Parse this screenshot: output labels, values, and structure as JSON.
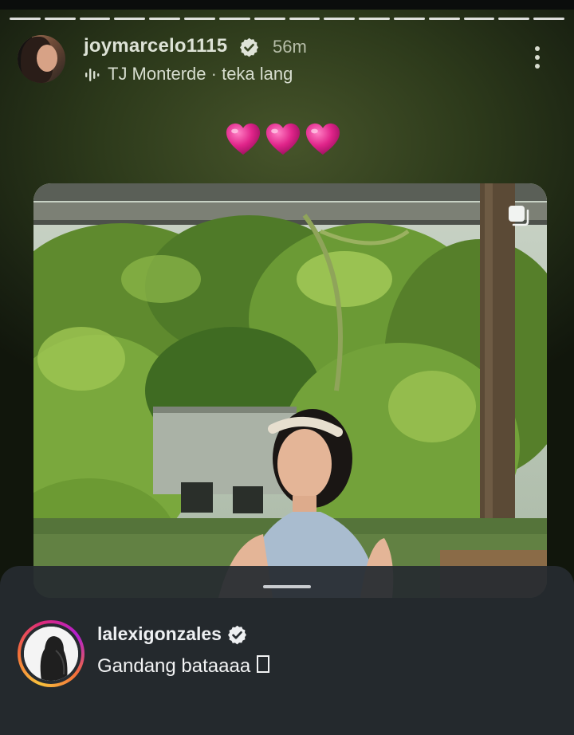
{
  "story": {
    "progress_segments": 16,
    "progress_active": 16,
    "user": {
      "username": "joymarcelo1115",
      "verified": true,
      "time_ago": "56m"
    },
    "music": {
      "icon": "audio-bars-icon",
      "artist": "TJ Monterde",
      "separator": "·",
      "song": "teka lang"
    },
    "more_icon": "more-vertical-icon",
    "caption_emoji": [
      "💗",
      "💗",
      "💗"
    ],
    "photo": {
      "multi_icon": "carousel-icon"
    }
  },
  "reply_sheet": {
    "commenter": "lalexigonzales",
    "verified": true,
    "comment_text": "Gandang bataaaa"
  },
  "colors": {
    "background_green": "#2d3a1b",
    "sheet": "#262b30",
    "ring_start": "#f9c23c",
    "ring_end": "#b31fd1",
    "heart": "#e0248a"
  }
}
